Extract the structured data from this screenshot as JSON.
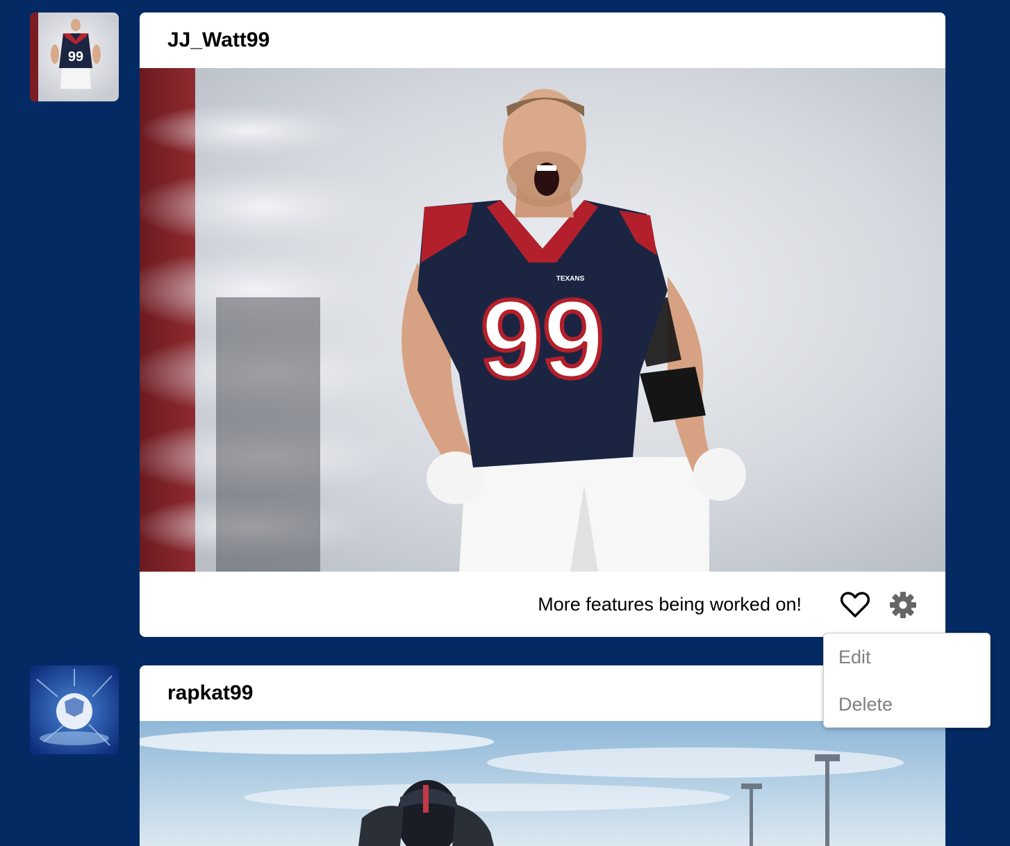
{
  "colors": {
    "background": "#032a62",
    "card": "#ffffff",
    "menu_text": "#808080",
    "gear": "#666666"
  },
  "posts": [
    {
      "username": "JJ_Watt99",
      "caption": "More features being worked on!",
      "like_icon": "heart-outline-icon",
      "settings_icon": "gear-icon"
    },
    {
      "username": "rapkat99"
    }
  ],
  "settings_menu": {
    "items": [
      {
        "label": "Edit"
      },
      {
        "label": "Delete"
      }
    ]
  }
}
